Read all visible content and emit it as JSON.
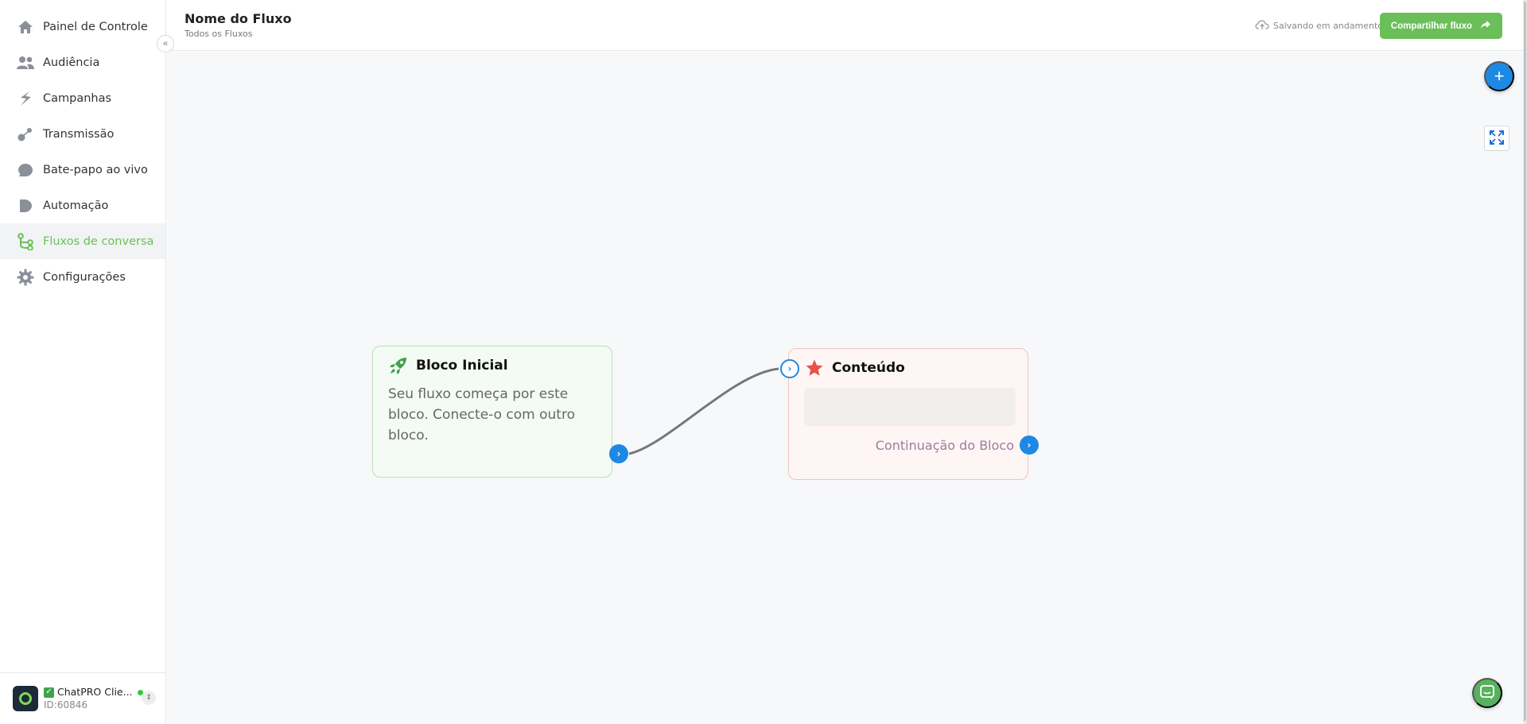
{
  "sidebar": {
    "items": [
      {
        "label": "Painel de Controle",
        "icon": "home-icon"
      },
      {
        "label": "Audiência",
        "icon": "users-icon"
      },
      {
        "label": "Campanhas",
        "icon": "bolt-icon"
      },
      {
        "label": "Transmissão",
        "icon": "broadcast-icon"
      },
      {
        "label": "Bate-papo ao vivo",
        "icon": "chat-bubble-icon"
      },
      {
        "label": "Automação",
        "icon": "automation-icon"
      },
      {
        "label": "Fluxos de conversa",
        "icon": "flow-icon",
        "active": true
      },
      {
        "label": "Configurações",
        "icon": "gear-icon"
      }
    ],
    "collapse_glyph": "«",
    "account": {
      "name": "ChatPRO Clie...",
      "id": "ID:60846",
      "status_color": "#2ecc40"
    }
  },
  "header": {
    "title": "Nome do Fluxo",
    "breadcrumb": "Todos os Fluxos",
    "saving_status": "Salvando em andamento",
    "share_label": "Compartilhar fluxo"
  },
  "canvas": {
    "add_glyph": "+",
    "blocks": {
      "start": {
        "title": "Bloco Inicial",
        "text": "Seu fluxo começa por este bloco. Conecte-o com outro bloco.",
        "icon": "rocket-icon"
      },
      "content": {
        "title": "Conteúdo",
        "continuation_label": "Continuação do Bloco",
        "icon": "star-icon"
      }
    },
    "port_glyph": "›"
  },
  "colors": {
    "accent_green": "#6bbf59",
    "accent_blue": "#1e88e5",
    "start_block_bg": "#f4fbf4",
    "content_block_bg": "#fdf6f5",
    "star_red": "#e5534b"
  }
}
